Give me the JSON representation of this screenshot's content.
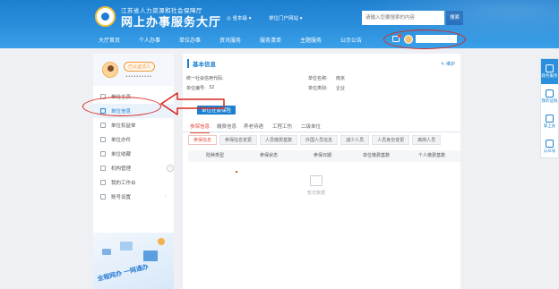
{
  "header": {
    "org_name": "江苏省人力资源和社会保障厅",
    "site_title": "网上办事服务大厅",
    "region": "◎ 省本级 ▾",
    "entry": "单位门户网站 ▾",
    "search_placeholder": "请输入您要搜索的内容",
    "search_label": "搜索",
    "brand_color": "#2b8fdc"
  },
  "nav": {
    "items": [
      "大厅首页",
      "个人办事",
      "单位办事",
      "资讯服务",
      "服务清单",
      "主题服务",
      "公示公告"
    ]
  },
  "sidebar": {
    "role_badge": "已认证法人",
    "user_id": "••••••••••",
    "items": [
      {
        "label": "单位主页",
        "icon": "home-icon"
      },
      {
        "label": "单位信息",
        "icon": "id-card-icon"
      },
      {
        "label": "单位权益单",
        "icon": "list-icon"
      },
      {
        "label": "单位办件",
        "icon": "file-icon"
      },
      {
        "label": "单位收藏",
        "icon": "star-icon"
      },
      {
        "label": "机构管理",
        "icon": "building-icon"
      },
      {
        "label": "我的工作台",
        "icon": "desk-icon"
      },
      {
        "label": "账号设置",
        "icon": "gear-icon"
      }
    ],
    "slogan": "全程网办 一网通办",
    "collapse": "‹"
  },
  "main": {
    "panel_title": "基本信息",
    "maintain_link": "✎ 维护",
    "info": {
      "credit_code_label": "统一社会信用代码:",
      "unit_name_label": "单位名称:",
      "unit_name_value": "南京",
      "unit_number_label": "单位编号:",
      "unit_number_value": "32",
      "unit_type_label": "单位类别:",
      "unit_type_value": "企业"
    },
    "section_tag": "单位社会保险",
    "tabs": [
      "参保信息",
      "缴费信息",
      "养老待遇",
      "工程工伤",
      "二级单位"
    ],
    "active_tab": 0,
    "subtabs": [
      "参保信息",
      "参保信息变更",
      "人员缴费基数",
      "外国人员信息",
      "减少人员",
      "人员身份变更",
      "离岗人员"
    ],
    "active_subtab": 0,
    "columns": [
      "险种类型",
      "参保状态",
      "参保日期",
      "单位缴费基数",
      "个人缴费基数"
    ],
    "empty_text": "暂无数据"
  },
  "floatbar": {
    "items": [
      {
        "label": "政务服务",
        "icon": "cloud-icon"
      },
      {
        "label": "我的证照",
        "icon": "card-icon"
      },
      {
        "label": "掌上办",
        "icon": "phone-icon"
      },
      {
        "label": "公众号",
        "icon": "wechat-icon"
      }
    ]
  },
  "annotation_color": "#d9261c"
}
